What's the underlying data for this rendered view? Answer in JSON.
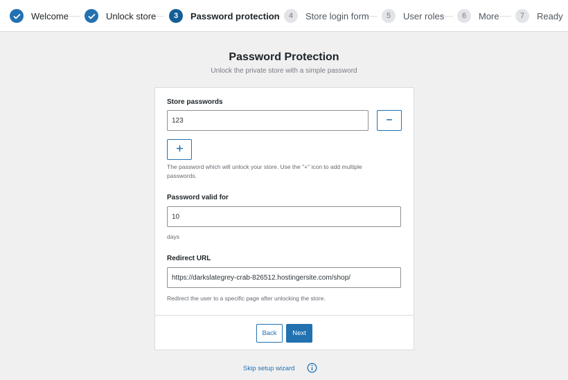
{
  "steps": [
    {
      "number": "1",
      "label": "Welcome",
      "status": "done"
    },
    {
      "number": "2",
      "label": "Unlock store",
      "status": "done"
    },
    {
      "number": "3",
      "label": "Password protection",
      "status": "current"
    },
    {
      "number": "4",
      "label": "Store login form",
      "status": "todo"
    },
    {
      "number": "5",
      "label": "User roles",
      "status": "todo"
    },
    {
      "number": "6",
      "label": "More",
      "status": "todo"
    },
    {
      "number": "7",
      "label": "Ready",
      "status": "todo"
    }
  ],
  "header": {
    "title": "Password Protection",
    "subtitle": "Unlock the private store with a simple password"
  },
  "form": {
    "store_passwords": {
      "label": "Store passwords",
      "value": "123",
      "help": "The password which will unlock your store. Use the \"+\" icon to add multiple passwords."
    },
    "valid_for": {
      "label": "Password valid for",
      "value": "10",
      "unit": "days"
    },
    "redirect_url": {
      "label": "Redirect URL",
      "value": "https://darkslategrey-crab-826512.hostingersite.com/shop/",
      "help": "Redirect the user to a specific page after unlocking the store."
    }
  },
  "actions": {
    "back_label": "Back",
    "next_label": "Next"
  },
  "footer": {
    "skip_label": "Skip setup wizard"
  },
  "icons": {
    "check": "check-icon",
    "minus": "minus-icon",
    "plus": "plus-icon",
    "info": "info-icon"
  },
  "colors": {
    "accent": "#2271b1",
    "current_step": "#135e96",
    "background": "#f0f0f1"
  }
}
